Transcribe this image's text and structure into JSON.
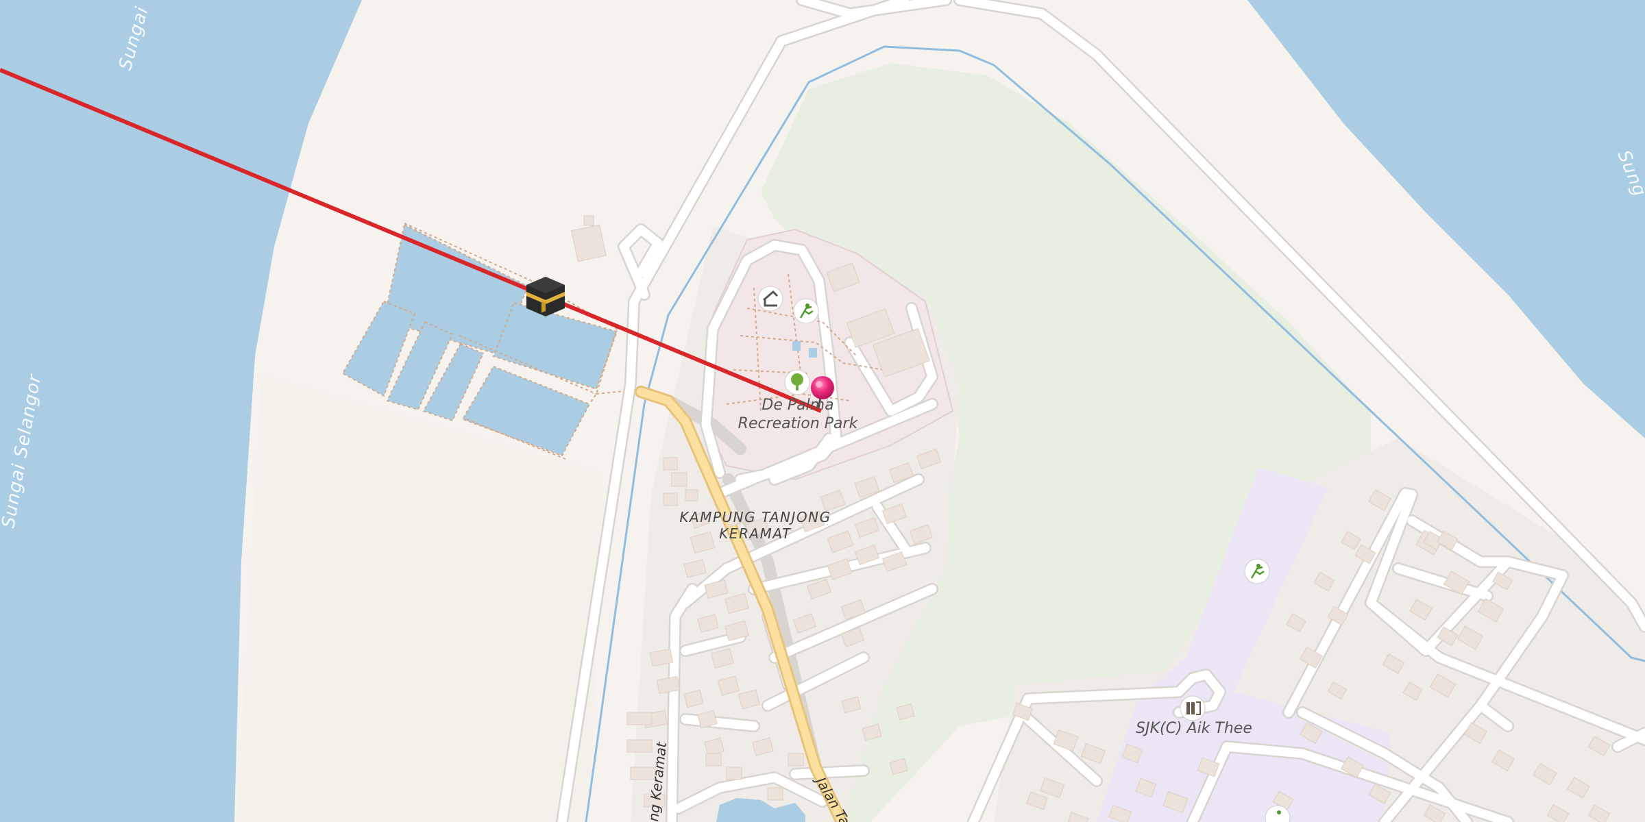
{
  "colors": {
    "land": "#f6f3ef",
    "water": "#aacde3",
    "park": "#e8eee0",
    "residential": "#f1eee9",
    "school": "#ebe5f6",
    "recreation": "#f2e6e6",
    "road": "#ffffff",
    "road_casing": "#d8d4cf",
    "major_road": "#fbe0a0",
    "major_road_casing": "#e8c27a",
    "building": "#ece2d9",
    "route_line": "#d9262a",
    "pin": "#e9277a"
  },
  "labels": {
    "water_north": "Sungai",
    "water_west": "Sungai Selangor",
    "water_east": "Sung",
    "park_line1": "De Palma",
    "park_line2": "Recreation Park",
    "village_line1": "KAMPUNG TANJONG",
    "village_line2": "KERAMAT",
    "school": "SJK(C) Aik Thee",
    "road_left": "ng Keramat",
    "road_main": "Jalan Tan"
  },
  "icons": {
    "kaaba": "kaaba-icon",
    "pin": "location-pin-icon",
    "park": "tree-icon",
    "sports": "sports-pitch-icon",
    "shelter": "shelter-icon",
    "school": "school-icon"
  }
}
